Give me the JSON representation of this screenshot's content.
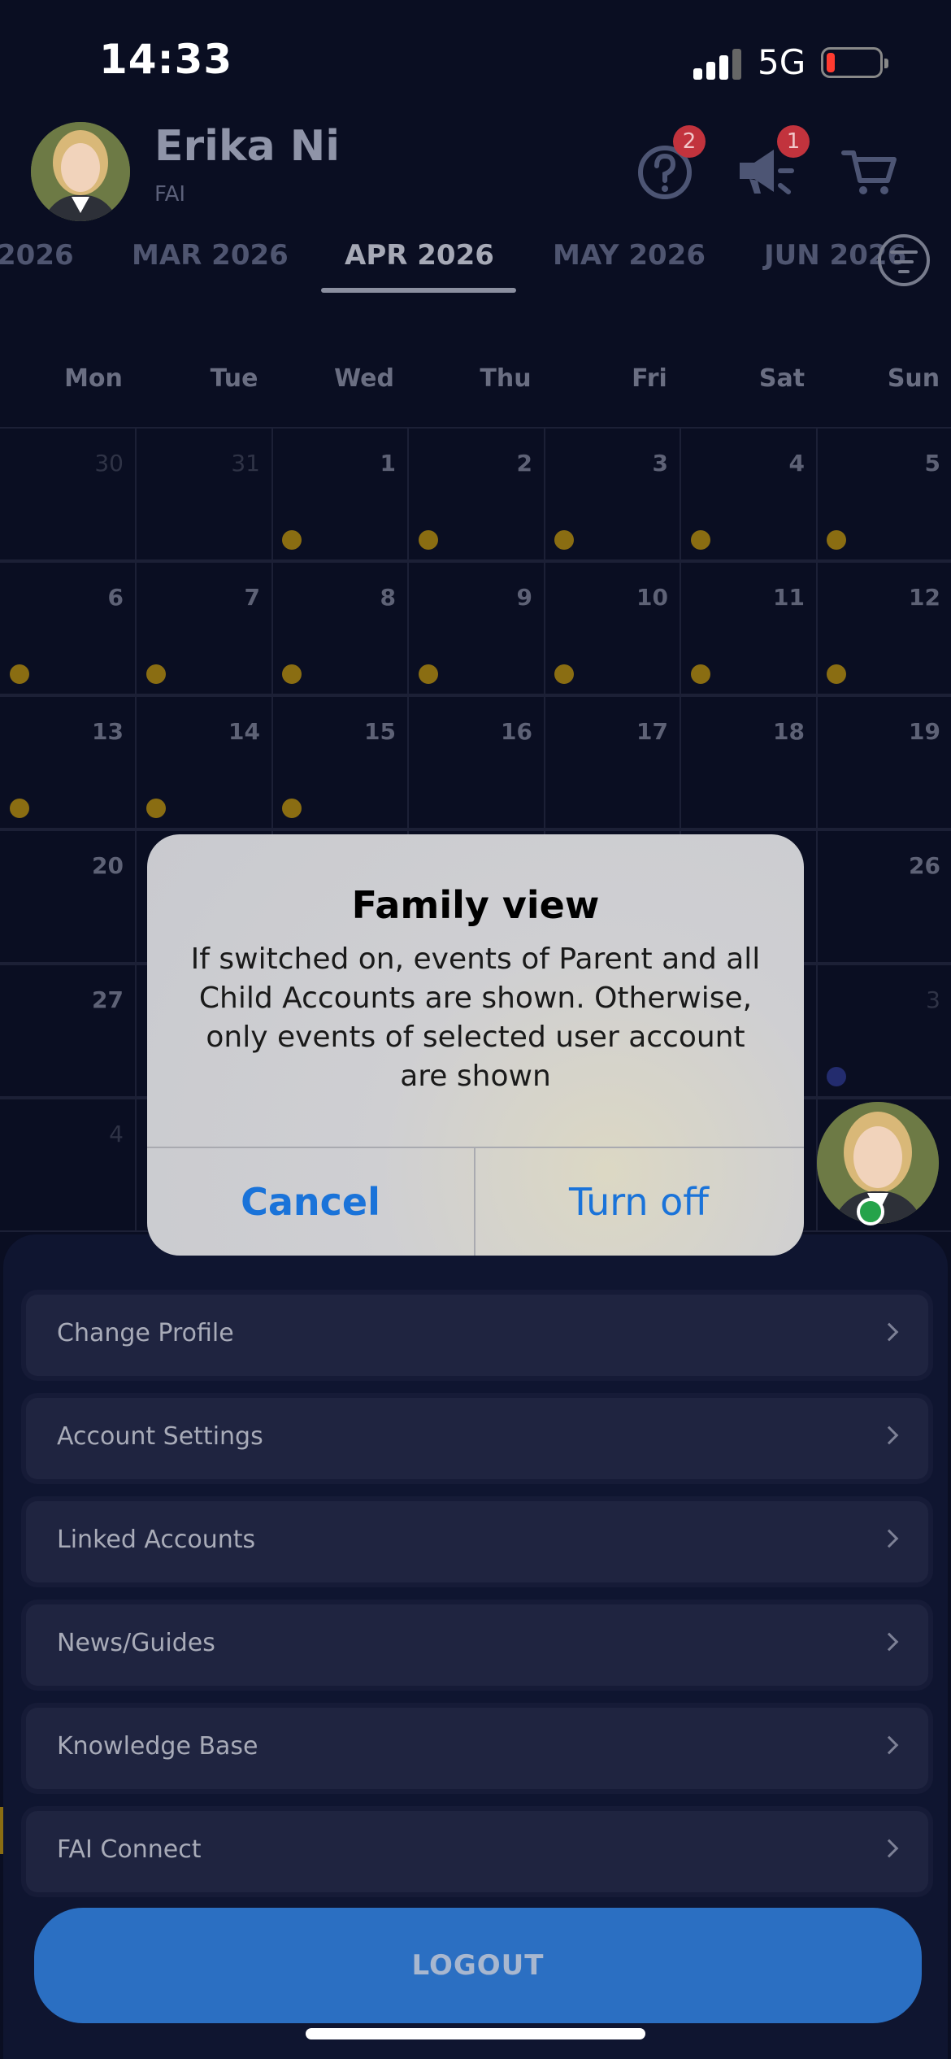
{
  "status_bar": {
    "time": "14:33",
    "network": "5G"
  },
  "header": {
    "user_name": "Erika Ni",
    "user_subtitle": "FAI",
    "help_badge": "2",
    "announcements_badge": "1"
  },
  "month_tabs": [
    "2026",
    "MAR 2026",
    "APR 2026",
    "MAY 2026",
    "JUN 2026"
  ],
  "active_month": "APR 2026",
  "calendar": {
    "weekdays": [
      "Mon",
      "Tue",
      "Wed",
      "Thu",
      "Fri",
      "Sat",
      "Sun"
    ],
    "rows": [
      [
        "30",
        "31",
        "1",
        "2",
        "3",
        "4",
        "5"
      ],
      [
        "6",
        "7",
        "8",
        "9",
        "10",
        "11",
        "12"
      ],
      [
        "13",
        "14",
        "15",
        "16",
        "17",
        "18",
        "19"
      ],
      [
        "20",
        "",
        "",
        "",
        "",
        "",
        "26"
      ],
      [
        "27",
        "",
        "",
        "",
        "",
        "",
        "3"
      ],
      [
        "4",
        "",
        "",
        "",
        "",
        "",
        ""
      ]
    ],
    "events_days": [
      "1",
      "2",
      "3",
      "4",
      "5",
      "6",
      "7",
      "8",
      "9",
      "10",
      "11",
      "12",
      "13",
      "14",
      "15"
    ]
  },
  "menu": {
    "items": [
      {
        "label": "Change Profile"
      },
      {
        "label": "Account Settings"
      },
      {
        "label": "Linked Accounts"
      },
      {
        "label": "News/Guides"
      },
      {
        "label": "Knowledge Base"
      },
      {
        "label": "FAI Connect"
      }
    ],
    "logout_label": "LOGOUT"
  },
  "dialog": {
    "title": "Family view",
    "message": "If switched on, events of Parent and all Child Accounts are shown. Otherwise, only events of selected user account are shown",
    "cancel_label": "Cancel",
    "confirm_label": "Turn off"
  },
  "colors": {
    "background": "#0a0e22",
    "event_dot": "#8a6d12",
    "accent_blue": "#1a73d9",
    "logout_button": "#2b6fc2",
    "badge_red": "#c2333d"
  }
}
